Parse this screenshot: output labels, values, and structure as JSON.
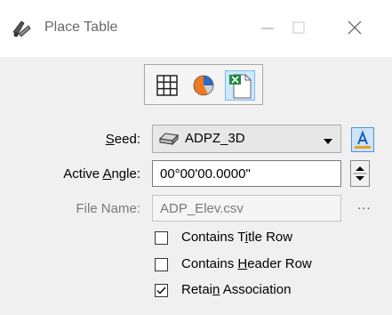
{
  "window": {
    "title": "Place Table"
  },
  "toolbar": {
    "buttons": [
      {
        "name": "table-grid-icon"
      },
      {
        "name": "pie-chart-icon"
      },
      {
        "name": "excel-file-icon",
        "active": true
      }
    ]
  },
  "form": {
    "seed_label_pre": "",
    "seed_label_u": "S",
    "seed_label_post": "eed:",
    "seed_value": "ADPZ_3D",
    "angle_label_pre": "Active ",
    "angle_label_u": "A",
    "angle_label_post": "ngle:",
    "angle_value": "00°00'00.0000\"",
    "file_label": "File Name:",
    "file_value": "ADP_Elev.csv",
    "browse_label": "..."
  },
  "options": [
    {
      "pre": "Contains T",
      "u": "i",
      "post": "tle Row",
      "checked": false
    },
    {
      "pre": "Contains ",
      "u": "H",
      "post": "eader Row",
      "checked": false
    },
    {
      "pre": "Retai",
      "u": "n",
      "post": " Association",
      "checked": true
    }
  ],
  "colors": {
    "accent": "#4a90d9",
    "active_button_bg": "#cde8ff",
    "panel_bg": "#f0f0f0"
  }
}
